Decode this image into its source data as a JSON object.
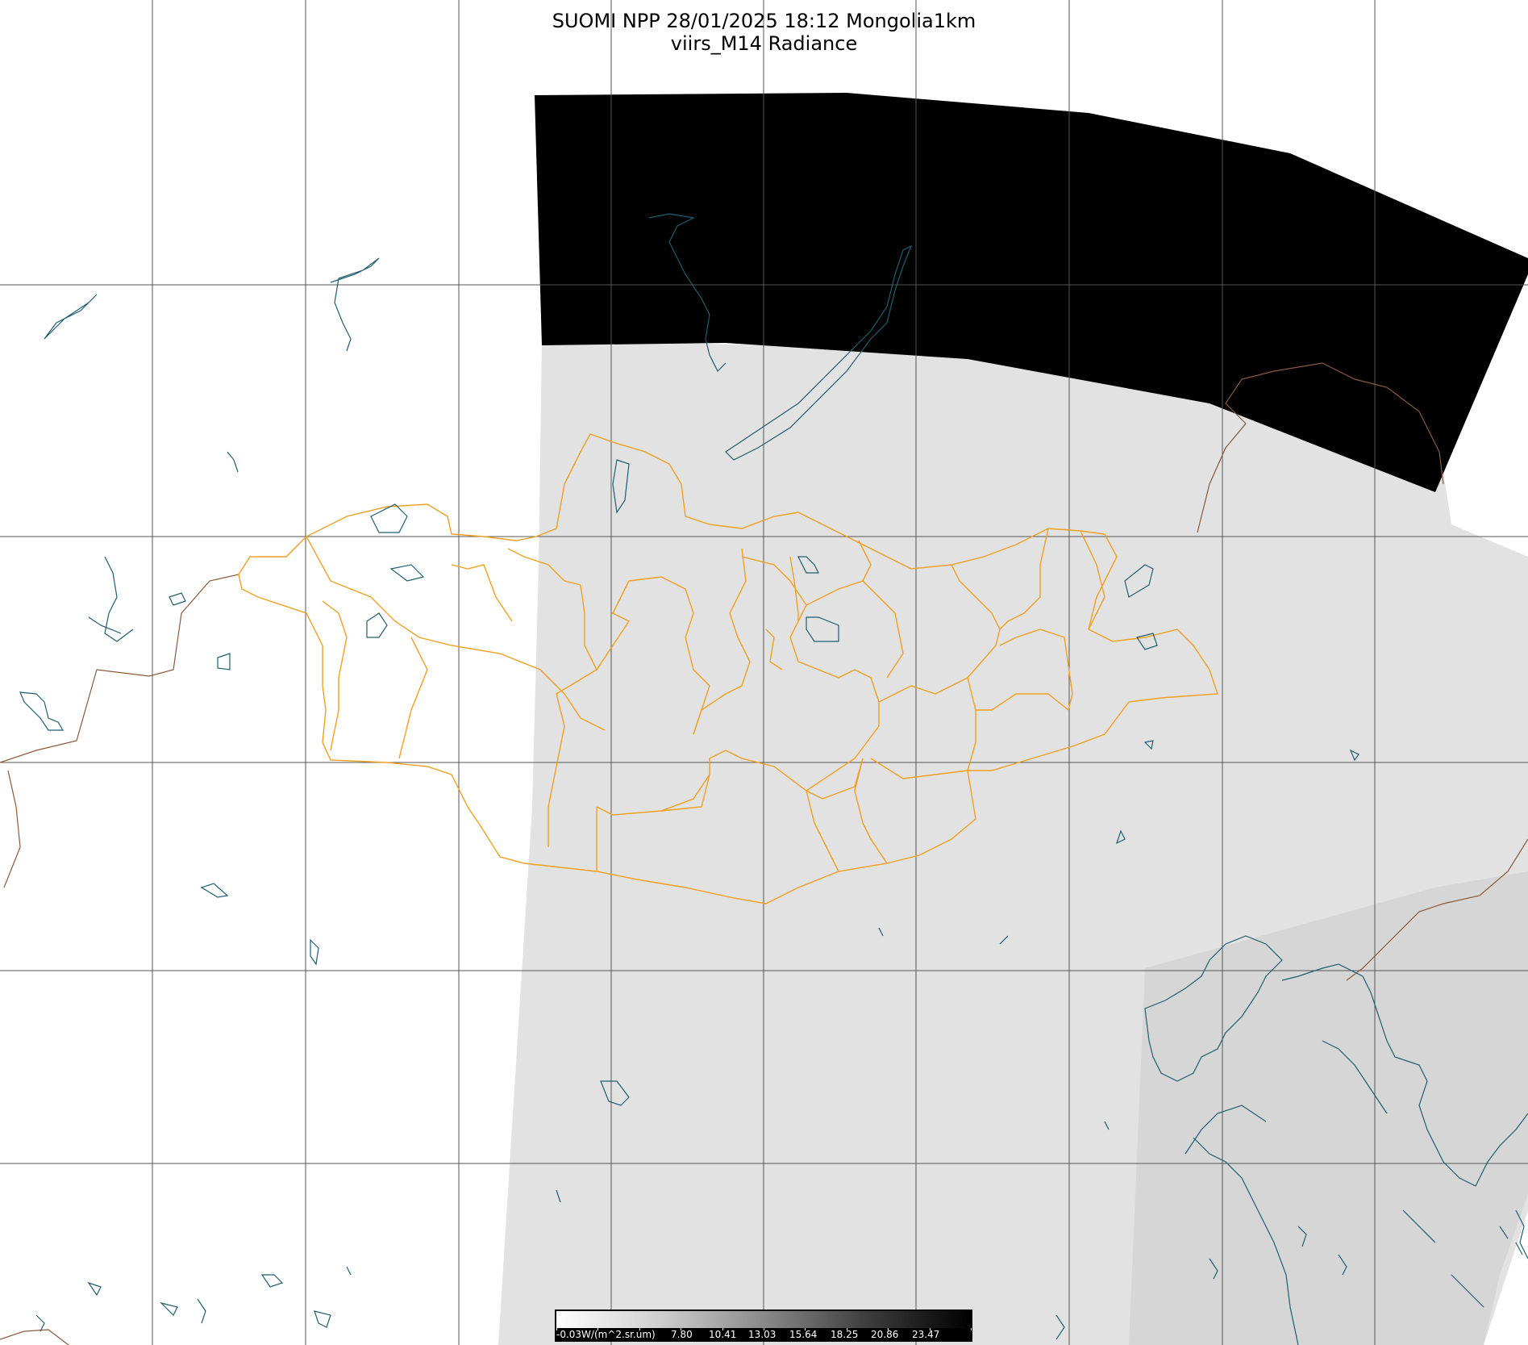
{
  "title": {
    "line1": "SUOMI NPP 28/01/2025 18:12 Mongolia1km",
    "line2": "viirs_M14 Radiance"
  },
  "map": {
    "background_color": "#ffffff",
    "swath_color": "#e2e2e2",
    "night_mask_color": "#000000",
    "grid_color": "#555555",
    "coastline_color": "#1f5f6f",
    "country_border_color": "#8a5a3a",
    "province_border_color": "#f0a020"
  },
  "colorbar": {
    "unit_label": "-0.03W/(m^2.sr.um)",
    "tick_labels": [
      "7.80",
      "10.41",
      "13.03",
      "15.64",
      "18.25",
      "20.86",
      "23.47"
    ]
  }
}
